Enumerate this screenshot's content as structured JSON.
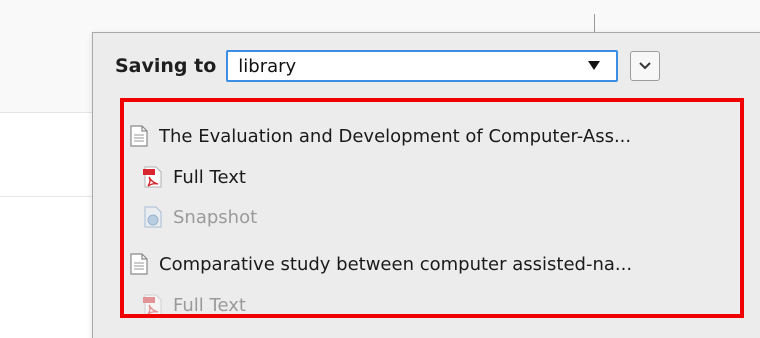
{
  "popup": {
    "saving_label": "Saving to",
    "collection_value": "library"
  },
  "items": [
    {
      "title": "The Evaluation and Development of Computer-Ass...",
      "icon": "document-icon"
    },
    {
      "title": "Full Text",
      "icon": "pdf-icon"
    },
    {
      "title": "Snapshot",
      "icon": "snapshot-icon"
    },
    {
      "title": "Comparative study between computer assisted-na...",
      "icon": "document-icon"
    },
    {
      "title": "Full Text",
      "icon": "pdf-icon"
    }
  ],
  "colors": {
    "highlight": "#f00000",
    "select_border": "#3c8ee5",
    "popup_bg": "#ececec"
  }
}
